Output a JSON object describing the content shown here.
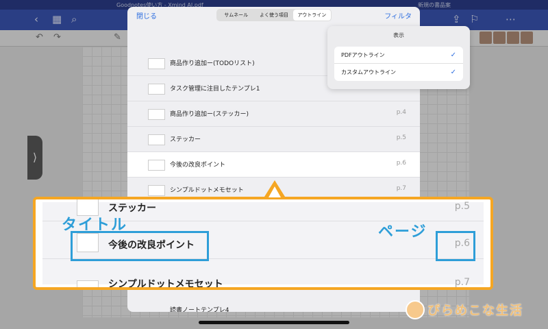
{
  "app": {
    "top_tabs": [
      "Goodnotes使い方 - Xmind AI.pdf",
      "新規の書品案"
    ],
    "nav_icons": [
      "back-icon",
      "grid-icon",
      "search-icon",
      "share-icon",
      "bookmark-icon",
      "more-icon"
    ]
  },
  "outline_panel": {
    "close_label": "閉じる",
    "filter_label": "フィルタ",
    "segments": [
      "サムネール",
      "よく使う項目",
      "アウトライン"
    ],
    "active_segment": "アウトライン",
    "rows": [
      {
        "title": "商品作り追加ー(TODOリスト)",
        "page": ""
      },
      {
        "title": "タスク管理に注目したテンプレ1",
        "page": ""
      },
      {
        "title": "商品作り追加ー(ステッカー)",
        "page": "p.4"
      },
      {
        "title": "ステッカー",
        "page": "p.5"
      },
      {
        "title": "今後の改良ポイント",
        "page": "p.6",
        "selected": true
      },
      {
        "title": "シンプルドットメモセット",
        "page": "p.7"
      }
    ],
    "bottom_row_title": "読書ノートテンプレ4"
  },
  "filter_popover": {
    "title": "表示",
    "items": [
      {
        "label": "PDFアウトライン",
        "checked": true
      },
      {
        "label": "カスタムアウトライン",
        "checked": true
      }
    ]
  },
  "callout": {
    "label_title": "タイトル",
    "label_page": "ページ",
    "zoom_rows": [
      {
        "title": "ステッカー",
        "page": "p.5"
      },
      {
        "title": "今後の改良ポイント",
        "page": "p.6"
      },
      {
        "title": "シンプルドットメモセット",
        "page": "p.7"
      }
    ],
    "accent_color": "#f5a623",
    "highlight_color": "#2e9ed8"
  },
  "watermark": {
    "text": "ぴらめこな生活"
  }
}
